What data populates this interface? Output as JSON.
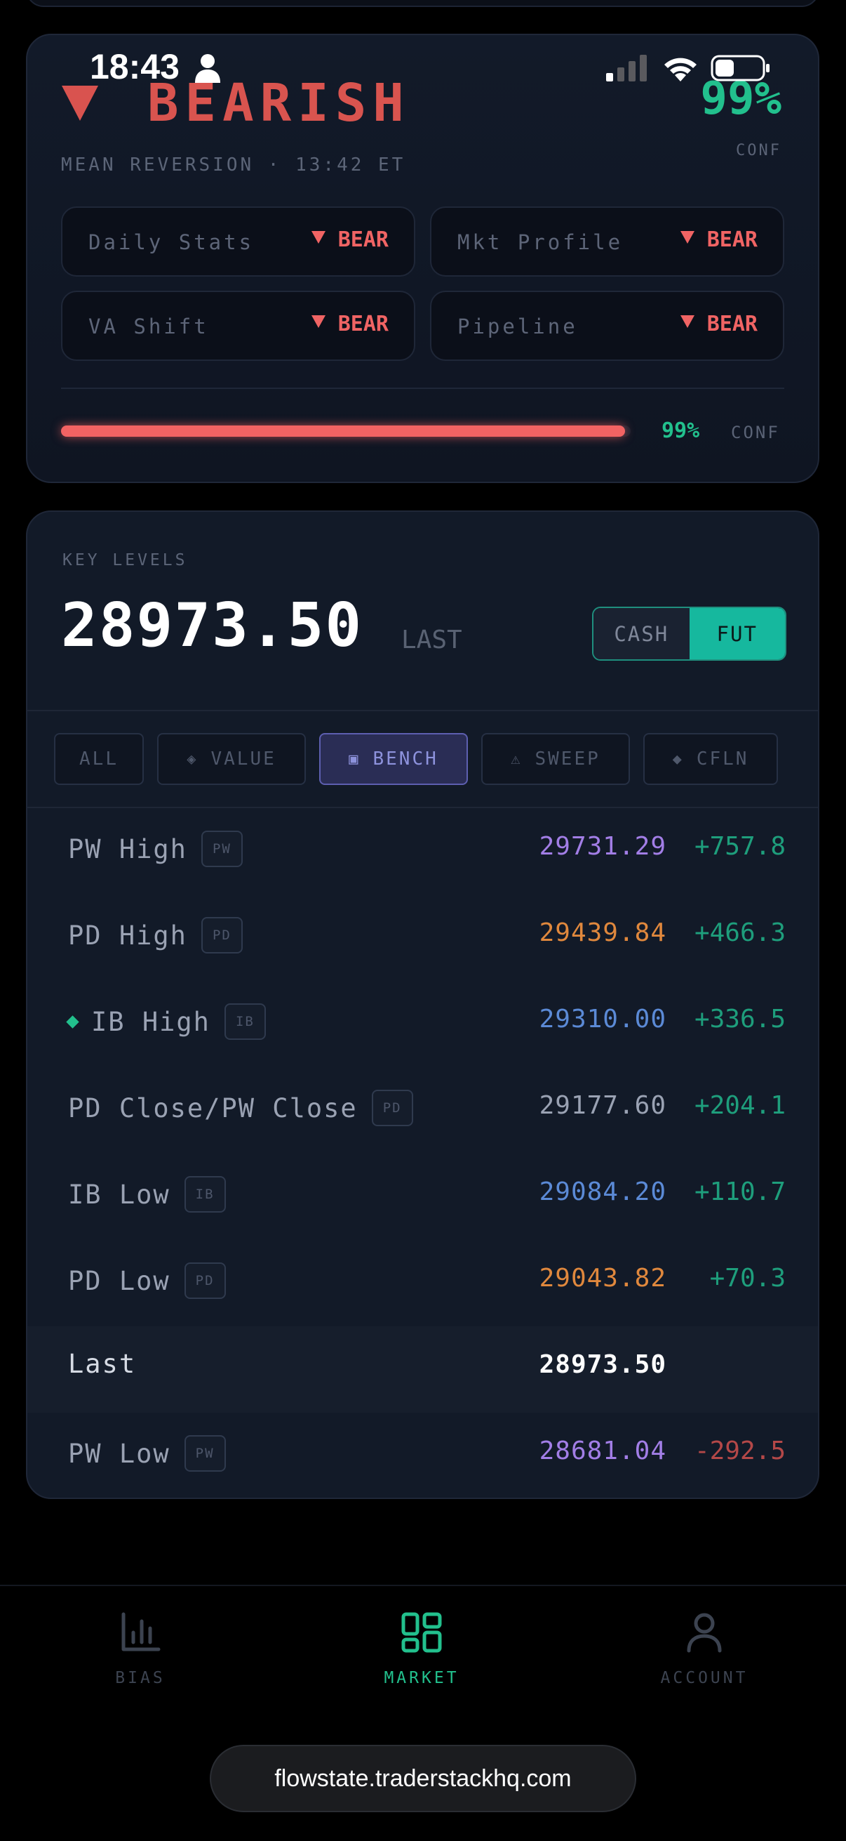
{
  "status_bar": {
    "time": "18:43"
  },
  "bias": {
    "direction": "BEARISH",
    "confidence": "99%",
    "confidence_label": "CONF",
    "subtitle": "MEAN REVERSION · 13:42 ET",
    "signals": [
      {
        "label": "Daily Stats",
        "value": "BEAR"
      },
      {
        "label": "Mkt Profile",
        "value": "BEAR"
      },
      {
        "label": "VA Shift",
        "value": "BEAR"
      },
      {
        "label": "Pipeline",
        "value": "BEAR"
      }
    ],
    "bar": {
      "fill_fraction": 0.99,
      "percent": "99%",
      "label": "CONF"
    },
    "colors": {
      "bear": "#f06464",
      "confidence": "#22c08d"
    }
  },
  "key_levels": {
    "title": "KEY LEVELS",
    "price": "28973.50",
    "price_label": "LAST",
    "toggle": {
      "cash": "CASH",
      "fut": "FUT",
      "selected": "FUT"
    },
    "filters": [
      {
        "icon": "",
        "label": "ALL",
        "active": false
      },
      {
        "icon": "◈",
        "label": "VALUE",
        "active": false
      },
      {
        "icon": "▣",
        "label": "BENCH",
        "active": true
      },
      {
        "icon": "⚠",
        "label": "SWEEP",
        "active": false
      },
      {
        "icon": "◆",
        "label": "CFLN",
        "active": false
      }
    ],
    "levels": [
      {
        "name": "PW High",
        "tag": "PW",
        "price": "29731.29",
        "delta": "+757.8",
        "color": "purple"
      },
      {
        "name": "PD High",
        "tag": "PD",
        "price": "29439.84",
        "delta": "+466.3",
        "color": "orange"
      },
      {
        "name": "IB High",
        "tag": "IB",
        "price": "29310.00",
        "delta": "+336.5",
        "color": "blue",
        "marker": true
      },
      {
        "name": "PD Close/PW Close",
        "tag": "PD",
        "price": "29177.60",
        "delta": "+204.1",
        "color": "gray"
      },
      {
        "name": "IB Low",
        "tag": "IB",
        "price": "29084.20",
        "delta": "+110.7",
        "color": "blue"
      },
      {
        "name": "PD Low",
        "tag": "PD",
        "price": "29043.82",
        "delta": "+70.3",
        "color": "orange"
      },
      {
        "name": "Last",
        "tag": "",
        "price": "28973.50",
        "delta": "",
        "color": "white"
      },
      {
        "name": "PW Low",
        "tag": "PW",
        "price": "28681.04",
        "delta": "-292.5",
        "color": "purple"
      }
    ]
  },
  "nav": {
    "items": [
      {
        "label": "BIAS",
        "icon": "bar-chart-icon",
        "active": false
      },
      {
        "label": "MARKET",
        "icon": "grid-icon",
        "active": true
      },
      {
        "label": "ACCOUNT",
        "icon": "person-icon",
        "active": false
      }
    ]
  },
  "browser": {
    "url": "flowstate.traderstackhq.com"
  }
}
